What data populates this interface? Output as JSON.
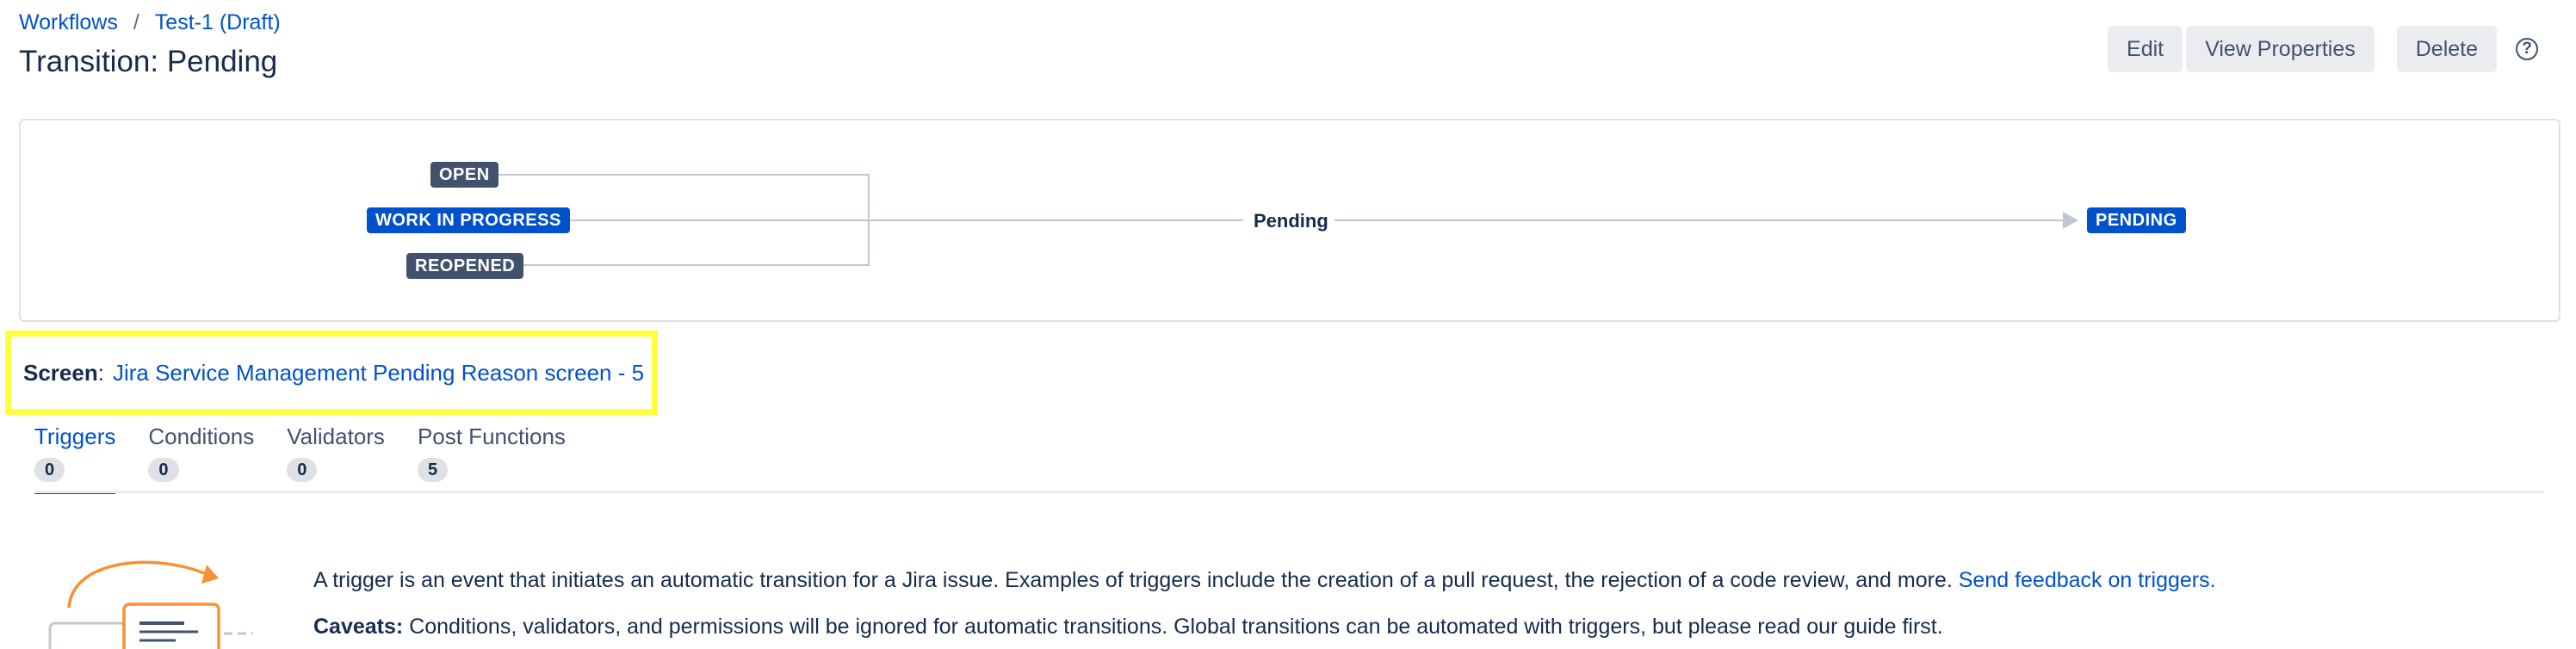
{
  "breadcrumb": {
    "workflows": "Workflows",
    "separator": "/",
    "workflow": "Test-1 (Draft)"
  },
  "page_title": "Transition: Pending",
  "toolbar": {
    "edit": "Edit",
    "view_properties": "View Properties",
    "delete": "Delete",
    "help": "?"
  },
  "diagram": {
    "from_statuses": [
      "OPEN",
      "WORK IN PROGRESS",
      "REOPENED"
    ],
    "transition_name": "Pending",
    "to_status": "PENDING"
  },
  "screen": {
    "label": "Screen",
    "colon": ":",
    "value": "Jira Service Management Pending Reason screen - 5"
  },
  "tabs": [
    {
      "label": "Triggers",
      "count": "0",
      "active": true
    },
    {
      "label": "Conditions",
      "count": "0"
    },
    {
      "label": "Validators",
      "count": "0"
    },
    {
      "label": "Post Functions",
      "count": "5"
    }
  ],
  "content": {
    "description": "A trigger is an event that initiates an automatic transition for a Jira issue. Examples of triggers include the creation of a pull request, the rejection of a code review, and more.",
    "feedback_link": "Send feedback on triggers.",
    "caveats_label": "Caveats:",
    "caveats_text": "Conditions, validators, and permissions will be ignored for automatic transitions. Global transitions can be automated with triggers, but please read our guide first."
  },
  "colors": {
    "link": "#0052cc",
    "highlight": "#ffff40",
    "status_dark": "#42526e",
    "status_blue": "#0052cc"
  }
}
